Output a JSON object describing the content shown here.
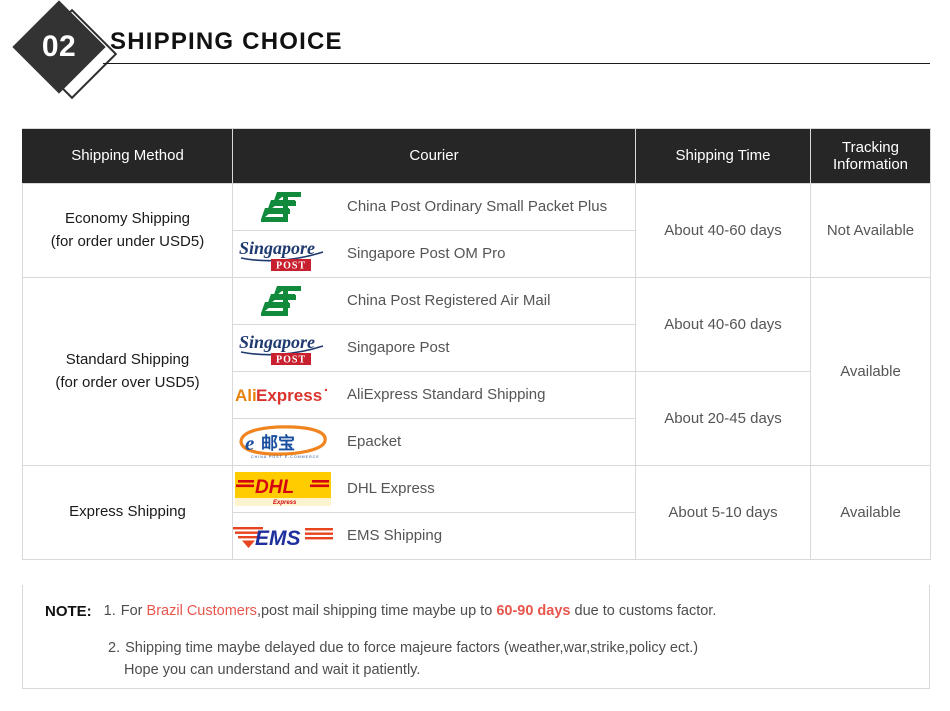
{
  "section": {
    "number": "02",
    "title": "SHIPPING CHOICE"
  },
  "table": {
    "headers": {
      "method": "Shipping Method",
      "courier": "Courier",
      "time": "Shipping Time",
      "tracking": "Tracking Information"
    },
    "groups": [
      {
        "method_line1": "Economy Shipping",
        "method_line2": "(for order under USD5)",
        "tracking": "Not Available",
        "rows": [
          {
            "logo": "china-post-logo",
            "name": "China Post Ordinary Small Packet Plus"
          },
          {
            "logo": "singapore-post-logo",
            "name": "Singapore Post OM Pro"
          }
        ],
        "times": [
          {
            "label": "About 40-60 days",
            "span": 2
          }
        ]
      },
      {
        "method_line1": "Standard Shipping",
        "method_line2": "(for order over USD5)",
        "tracking": "Available",
        "rows": [
          {
            "logo": "china-post-logo",
            "name": "China Post Registered Air Mail"
          },
          {
            "logo": "singapore-post-logo",
            "name": "Singapore Post"
          },
          {
            "logo": "aliexpress-logo",
            "name": "AliExpress Standard Shipping"
          },
          {
            "logo": "epacket-logo",
            "name": "Epacket"
          }
        ],
        "times": [
          {
            "label": "About 40-60 days",
            "span": 2
          },
          {
            "label": "About 20-45 days",
            "span": 2
          }
        ]
      },
      {
        "method_line1": "Express Shipping",
        "method_line2": "",
        "tracking": "Available",
        "rows": [
          {
            "logo": "dhl-logo",
            "name": "DHL Express"
          },
          {
            "logo": "ems-logo",
            "name": "EMS Shipping"
          }
        ],
        "times": [
          {
            "label": "About 5-10 days",
            "span": 2
          }
        ]
      }
    ]
  },
  "note": {
    "label": "NOTE:",
    "item1_num": "1.",
    "item1_a": "For ",
    "item1_red1": "Brazil Customers",
    "item1_b": ",post mail shipping time maybe up to ",
    "item1_red2": "60-90 days",
    "item1_c": " due to customs factor.",
    "item2_num": "2.",
    "item2_line1": "Shipping time maybe delayed due to force majeure factors (weather,war,strike,policy ect.)",
    "item2_line2": "Hope you can understand and wait it patiently."
  },
  "colors": {
    "header_bg": "#262626",
    "red_accent": "#e8564d",
    "china_post_green": "#128a3c",
    "singapore_navy": "#1f3a6e",
    "singapore_red": "#c8202e",
    "ali_orange": "#e8820c",
    "ali_red": "#d9342b",
    "dhl_yellow": "#ffcc00",
    "dhl_red": "#d40511",
    "ems_blue": "#1f2f9e",
    "ems_red": "#e8441f"
  }
}
